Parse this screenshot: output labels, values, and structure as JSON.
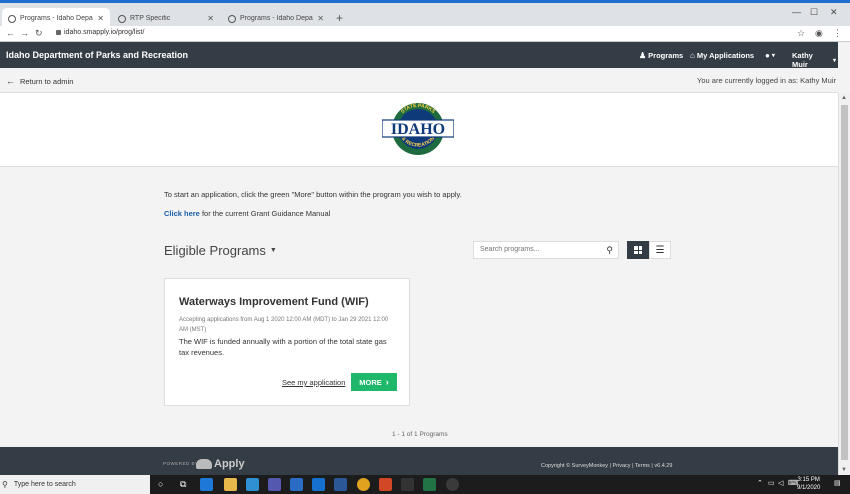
{
  "browser": {
    "tabs": [
      {
        "label": "Programs - Idaho Department of"
      },
      {
        "label": "RTP Specific"
      },
      {
        "label": "Programs - Idaho Department of"
      }
    ],
    "url": "idaho.smapply.io/prog/list/"
  },
  "header": {
    "brand": "Idaho Department of Parks and Recreation",
    "programs": "Programs",
    "my_applications": "My Applications",
    "user": "Kathy Muir"
  },
  "subbar": {
    "return_label": "Return to admin",
    "logged_in": "You are currently logged in as: Kathy Muir"
  },
  "logo": {
    "arc_top": "STATE PARKS",
    "word": "IDAHO",
    "arc_bottom": "& RECREATION"
  },
  "content": {
    "intro": "To start an application, click the green \"More\" button within the program you wish to apply.",
    "click_here": "Click here",
    "guidance_rest": " for the current Grant Guidance Manual",
    "eligible": "Eligible Programs",
    "search_placeholder": "Search programs...",
    "count": "1 - 1 of 1 Programs"
  },
  "card": {
    "title": "Waterways Improvement Fund (WIF)",
    "accepting": "Accepting applications from Aug 1 2020 12:00 AM (MDT) to Jan 29 2021 12:00 AM (MST)",
    "description": "The WIF is funded annually with a portion of the total state gas tax revenues.",
    "see_application": "See my application",
    "more": "MORE"
  },
  "footer": {
    "powered_by": "POWERED BY",
    "apply": "Apply",
    "copyright": "Copyright © SurveyMonkey | Privacy | Terms | v6.4.29"
  },
  "taskbar": {
    "search": "Type here to search",
    "time": "3:15 PM",
    "date": "9/1/2020"
  },
  "colors": {
    "header_bg": "#343c45",
    "more_button": "#1fb86b",
    "link": "#1b5fa8",
    "logo_green": "#1d6b3e",
    "logo_navy": "#0f3a7a"
  }
}
